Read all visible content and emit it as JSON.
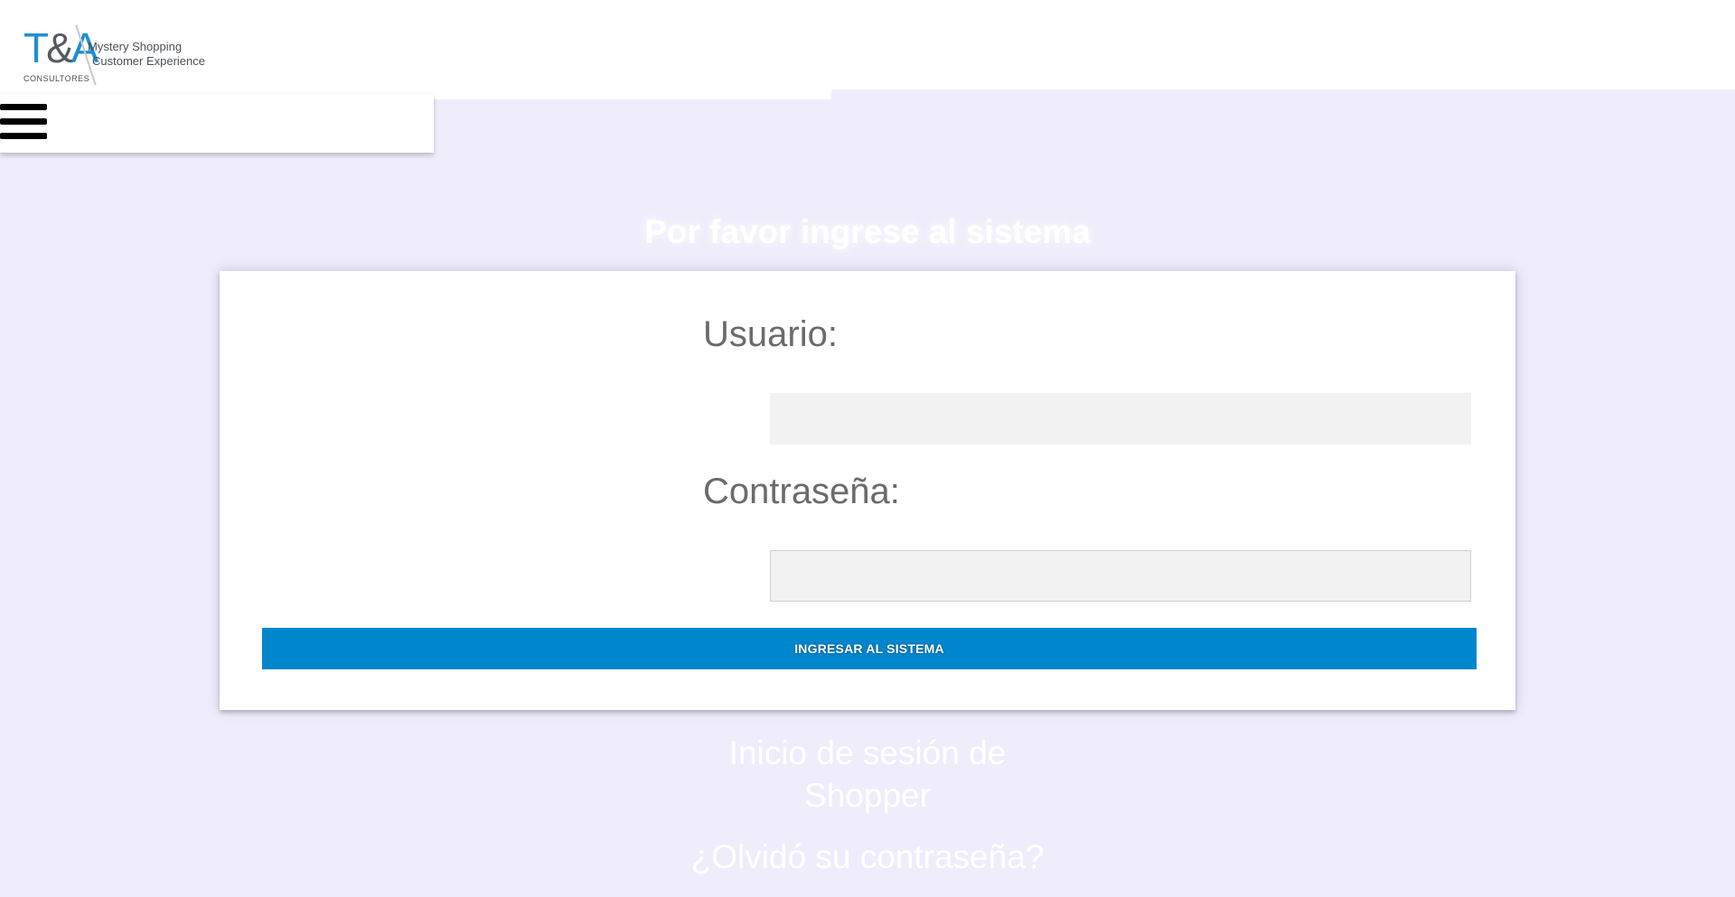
{
  "header": {
    "logo": {
      "mark_letters": "T",
      "mark_amp": "&",
      "mark_letter2": "A",
      "tagline_1": "Mystery Shopping",
      "tagline_2": "Customer Experience",
      "company": "CONSULTORES"
    },
    "menu_icon": "hamburger-menu-icon"
  },
  "login": {
    "heading": "Por favor ingrese al sistema",
    "username_label": "Usuario:",
    "username_value": "",
    "password_label": "Contraseña:",
    "password_value": "",
    "submit_label": "INGRESAR AL SISTEMA"
  },
  "links": {
    "shopper_login": "Inicio de sesión de Shopper",
    "forgot_password": "¿Olvidó su contraseña?"
  },
  "colors": {
    "background": "#efedfb",
    "brand_blue": "#1e8fd0",
    "button_blue": "#0086cd",
    "label_gray": "#6b6b6b",
    "input_bg": "#f2f2f2"
  }
}
